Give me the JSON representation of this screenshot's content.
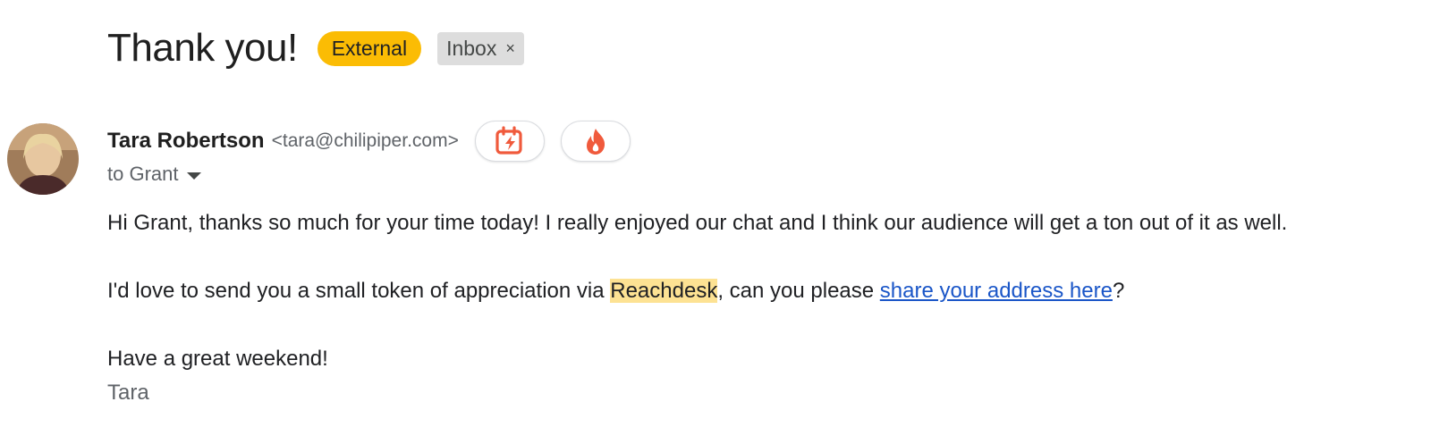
{
  "subject": {
    "title": "Thank you!",
    "labels": {
      "external": "External",
      "inbox": "Inbox",
      "inbox_remove": "×"
    }
  },
  "sender": {
    "name": "Tara Robertson",
    "email": "<tara@chilipiper.com>",
    "recipient_line": "to Grant",
    "actions": [
      {
        "icon": "calendar-lightning-icon"
      },
      {
        "icon": "chili-flame-icon"
      }
    ]
  },
  "message": {
    "para1": "Hi Grant, thanks so much for your time today! I really enjoyed our chat and I think our audience will get a ton out of it as well.",
    "para2_before": "I'd love to send you a small token of appreciation via ",
    "para2_highlight": "Reachdesk",
    "para2_middle": ", can you please ",
    "para2_link": "share your address here",
    "para2_after": "?",
    "para3": "Have a great weekend!",
    "signature": "Tara"
  },
  "colors": {
    "external_label": "#fbbc04",
    "inbox_label": "#dddddd",
    "highlight": "#fde293",
    "link": "#1a56c8",
    "brand_icon": "#f05a3c"
  }
}
